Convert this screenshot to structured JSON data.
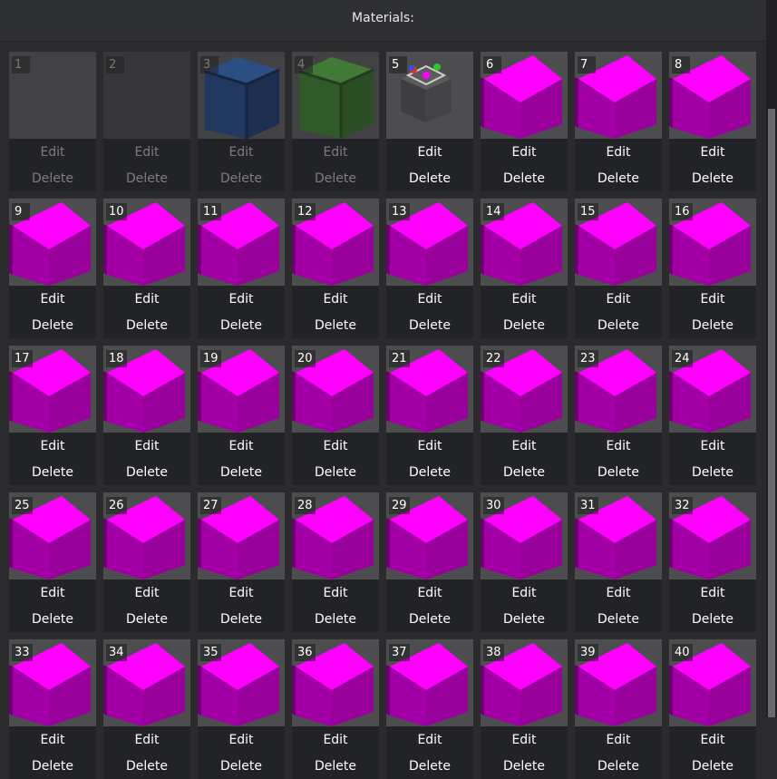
{
  "header": {
    "title": "Materials:"
  },
  "colors": {
    "magenta": "#ff00ff",
    "blue": "#1f4c8c",
    "green": "#3a7a2a",
    "panel": "#222326"
  },
  "materials": [
    {
      "number": "1",
      "edit": "Edit",
      "delete": "Delete",
      "preview": "empty",
      "enabled": false
    },
    {
      "number": "2",
      "edit": "Edit",
      "delete": "Delete",
      "preview": "empty-dark",
      "enabled": false
    },
    {
      "number": "3",
      "edit": "Edit",
      "delete": "Delete",
      "preview": "blue-cube",
      "enabled": false
    },
    {
      "number": "4",
      "edit": "Edit",
      "delete": "Delete",
      "preview": "green-cube",
      "enabled": false
    },
    {
      "number": "5",
      "edit": "Edit",
      "delete": "Delete",
      "preview": "gizmo-cube",
      "enabled": true
    },
    {
      "number": "6",
      "edit": "Edit",
      "delete": "Delete",
      "preview": "magenta-cube",
      "enabled": true
    },
    {
      "number": "7",
      "edit": "Edit",
      "delete": "Delete",
      "preview": "magenta-cube",
      "enabled": true
    },
    {
      "number": "8",
      "edit": "Edit",
      "delete": "Delete",
      "preview": "magenta-cube",
      "enabled": true
    },
    {
      "number": "9",
      "edit": "Edit",
      "delete": "Delete",
      "preview": "magenta-cube",
      "enabled": true
    },
    {
      "number": "10",
      "edit": "Edit",
      "delete": "Delete",
      "preview": "magenta-cube",
      "enabled": true
    },
    {
      "number": "11",
      "edit": "Edit",
      "delete": "Delete",
      "preview": "magenta-cube",
      "enabled": true
    },
    {
      "number": "12",
      "edit": "Edit",
      "delete": "Delete",
      "preview": "magenta-cube",
      "enabled": true
    },
    {
      "number": "13",
      "edit": "Edit",
      "delete": "Delete",
      "preview": "magenta-cube",
      "enabled": true
    },
    {
      "number": "14",
      "edit": "Edit",
      "delete": "Delete",
      "preview": "magenta-cube",
      "enabled": true
    },
    {
      "number": "15",
      "edit": "Edit",
      "delete": "Delete",
      "preview": "magenta-cube",
      "enabled": true
    },
    {
      "number": "16",
      "edit": "Edit",
      "delete": "Delete",
      "preview": "magenta-cube",
      "enabled": true
    },
    {
      "number": "17",
      "edit": "Edit",
      "delete": "Delete",
      "preview": "magenta-cube",
      "enabled": true
    },
    {
      "number": "18",
      "edit": "Edit",
      "delete": "Delete",
      "preview": "magenta-cube",
      "enabled": true
    },
    {
      "number": "19",
      "edit": "Edit",
      "delete": "Delete",
      "preview": "magenta-cube",
      "enabled": true
    },
    {
      "number": "20",
      "edit": "Edit",
      "delete": "Delete",
      "preview": "magenta-cube",
      "enabled": true
    },
    {
      "number": "21",
      "edit": "Edit",
      "delete": "Delete",
      "preview": "magenta-cube",
      "enabled": true
    },
    {
      "number": "22",
      "edit": "Edit",
      "delete": "Delete",
      "preview": "magenta-cube",
      "enabled": true
    },
    {
      "number": "23",
      "edit": "Edit",
      "delete": "Delete",
      "preview": "magenta-cube",
      "enabled": true
    },
    {
      "number": "24",
      "edit": "Edit",
      "delete": "Delete",
      "preview": "magenta-cube",
      "enabled": true
    },
    {
      "number": "25",
      "edit": "Edit",
      "delete": "Delete",
      "preview": "magenta-cube",
      "enabled": true
    },
    {
      "number": "26",
      "edit": "Edit",
      "delete": "Delete",
      "preview": "magenta-cube",
      "enabled": true
    },
    {
      "number": "27",
      "edit": "Edit",
      "delete": "Delete",
      "preview": "magenta-cube",
      "enabled": true
    },
    {
      "number": "28",
      "edit": "Edit",
      "delete": "Delete",
      "preview": "magenta-cube",
      "enabled": true
    },
    {
      "number": "29",
      "edit": "Edit",
      "delete": "Delete",
      "preview": "magenta-cube",
      "enabled": true
    },
    {
      "number": "30",
      "edit": "Edit",
      "delete": "Delete",
      "preview": "magenta-cube",
      "enabled": true
    },
    {
      "number": "31",
      "edit": "Edit",
      "delete": "Delete",
      "preview": "magenta-cube",
      "enabled": true
    },
    {
      "number": "32",
      "edit": "Edit",
      "delete": "Delete",
      "preview": "magenta-cube",
      "enabled": true
    },
    {
      "number": "33",
      "edit": "Edit",
      "delete": "Delete",
      "preview": "magenta-cube",
      "enabled": true
    },
    {
      "number": "34",
      "edit": "Edit",
      "delete": "Delete",
      "preview": "magenta-cube",
      "enabled": true
    },
    {
      "number": "35",
      "edit": "Edit",
      "delete": "Delete",
      "preview": "magenta-cube",
      "enabled": true
    },
    {
      "number": "36",
      "edit": "Edit",
      "delete": "Delete",
      "preview": "magenta-cube",
      "enabled": true
    },
    {
      "number": "37",
      "edit": "Edit",
      "delete": "Delete",
      "preview": "magenta-cube",
      "enabled": true
    },
    {
      "number": "38",
      "edit": "Edit",
      "delete": "Delete",
      "preview": "magenta-cube",
      "enabled": true
    },
    {
      "number": "39",
      "edit": "Edit",
      "delete": "Delete",
      "preview": "magenta-cube",
      "enabled": true
    },
    {
      "number": "40",
      "edit": "Edit",
      "delete": "Delete",
      "preview": "magenta-cube",
      "enabled": true
    }
  ]
}
